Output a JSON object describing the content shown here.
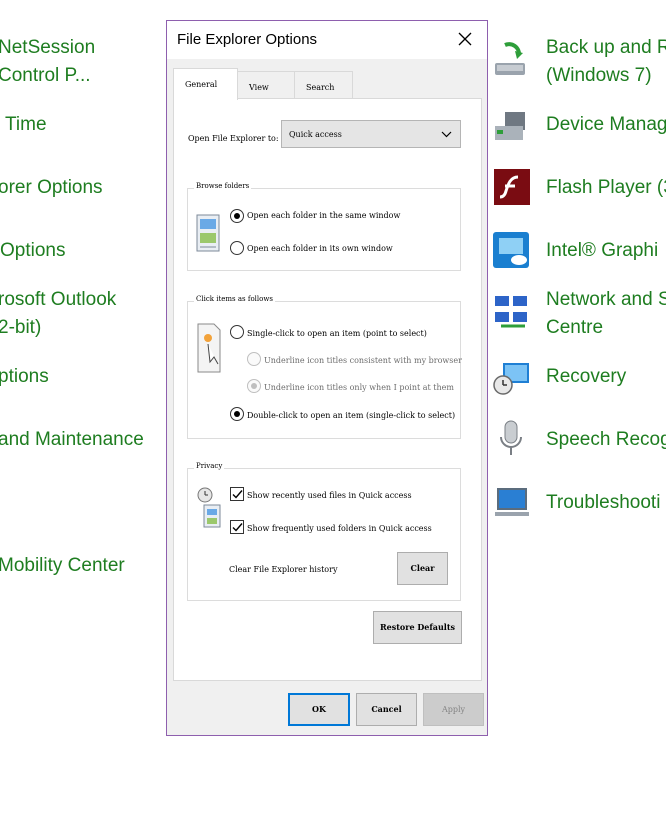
{
  "background": {
    "left_links": [
      "NetSession",
      "Control P...",
      "Time",
      "orer Options",
      "Options",
      "rosoft Outlook",
      "2-bit)",
      "ptions",
      "and Maintenance",
      "Mobility Center"
    ],
    "right_links": [
      "Back up and R",
      "(Windows 7)",
      "Device Manag",
      "Flash Player (3",
      "Intel® Graphi",
      "Network and S",
      "Centre",
      "Recovery",
      "Speech Recog",
      "Troubleshooti"
    ]
  },
  "dialog": {
    "title": "File Explorer Options",
    "tabs": [
      "General",
      "View",
      "Search"
    ],
    "open_label": "Open File Explorer to:",
    "open_value": "Quick access",
    "browse": {
      "title": "Browse folders",
      "same_window": "Open each folder in the same window",
      "own_window": "Open each folder in its own window"
    },
    "click": {
      "title": "Click items as follows",
      "single": "Single-click to open an item (point to select)",
      "underline_browser": "Underline icon titles consistent with my browser",
      "underline_point": "Underline icon titles only when I point at them",
      "double": "Double-click to open an item (single-click to select)"
    },
    "privacy": {
      "title": "Privacy",
      "recent_files": "Show recently used files in Quick access",
      "frequent_folders": "Show frequently used folders in Quick access",
      "clear_history": "Clear File Explorer history",
      "clear_button": "Clear"
    },
    "restore_defaults": "Restore Defaults",
    "ok": "OK",
    "cancel": "Cancel",
    "apply": "Apply"
  }
}
